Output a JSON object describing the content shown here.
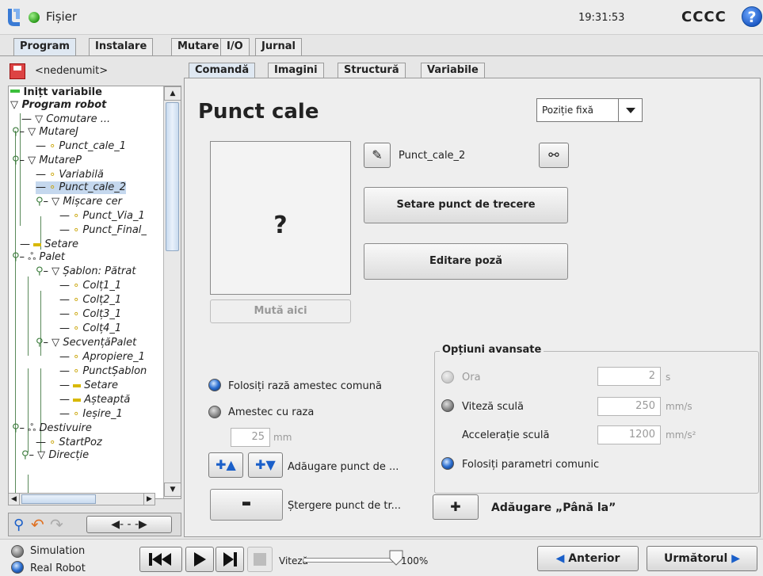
{
  "header": {
    "menu_label": "Fișier",
    "clock": "19:31:53",
    "robot_name": "CCCC",
    "help_label": "?"
  },
  "main_tabs": [
    "Program",
    "Instalare",
    "Mutare",
    "I/O",
    "Jurnal"
  ],
  "program": {
    "filename": "<nedenumit>"
  },
  "tree": [
    {
      "label": "Inițt variabile",
      "raw": "Inițt variabile"
    },
    {
      "label": "Program robot"
    },
    {
      "label": "Comutare ..."
    },
    {
      "label": "MutareJ"
    },
    {
      "label": "Punct_cale_1"
    },
    {
      "label": "MutareP"
    },
    {
      "label": "Variabilă"
    },
    {
      "label": "Punct_cale_2"
    },
    {
      "label": "Mișcare cer"
    },
    {
      "label": "Punct_Via_1"
    },
    {
      "label": "Punct_Final_"
    },
    {
      "label": "Setare"
    },
    {
      "label": "Palet"
    },
    {
      "label": "Șablon: Pătrat"
    },
    {
      "label": "Colț1_1"
    },
    {
      "label": "Colț2_1"
    },
    {
      "label": "Colț3_1"
    },
    {
      "label": "Colț4_1"
    },
    {
      "label": "SecvențăPalet"
    },
    {
      "label": "Apropiere_1"
    },
    {
      "label": "PunctȘablon"
    },
    {
      "label": "Setare"
    },
    {
      "label": "Așteaptă"
    },
    {
      "label": "Ieșire_1"
    },
    {
      "label": "Destivuire"
    },
    {
      "label": "StartPoz"
    },
    {
      "label": "Direcție"
    }
  ],
  "sub_tabs": [
    "Comandă",
    "Imagini",
    "Structură",
    "Variabile"
  ],
  "waypoint": {
    "title": "Punct cale",
    "type_select": "Poziție fixă",
    "name": "Punct_cale_2",
    "preview_text": "?",
    "move_here": "Mută aici",
    "set_waypoint": "Setare punct de trecere",
    "edit_pose": "Editare poză"
  },
  "blend": {
    "shared_label": "Folosiți rază amestec comună",
    "radius_label": "Amestec cu raza",
    "radius_value": "25",
    "radius_unit": "mm"
  },
  "actions": {
    "add_label": "Adăugare punct de ...",
    "delete_label": "Ștergere punct de tr...",
    "add_until": "Adăugare „Până la”"
  },
  "advanced": {
    "title": "Opțiuni avansate",
    "time_label": "Ora",
    "time_value": "2",
    "time_unit": "s",
    "speed_label": "Viteză sculă",
    "speed_value": "250",
    "speed_unit": "mm/s",
    "accel_label": "Accelerație sculă",
    "accel_value": "1200",
    "accel_unit": "mm/s²",
    "shared_label": "Folosiți parametri comunic"
  },
  "footer": {
    "simulation": "Simulation",
    "real_robot": "Real Robot",
    "speed_label": "Viteză",
    "speed_value": "100%",
    "speed_fraction": 1.0,
    "prev": "Anterior",
    "next": "Următorul"
  }
}
